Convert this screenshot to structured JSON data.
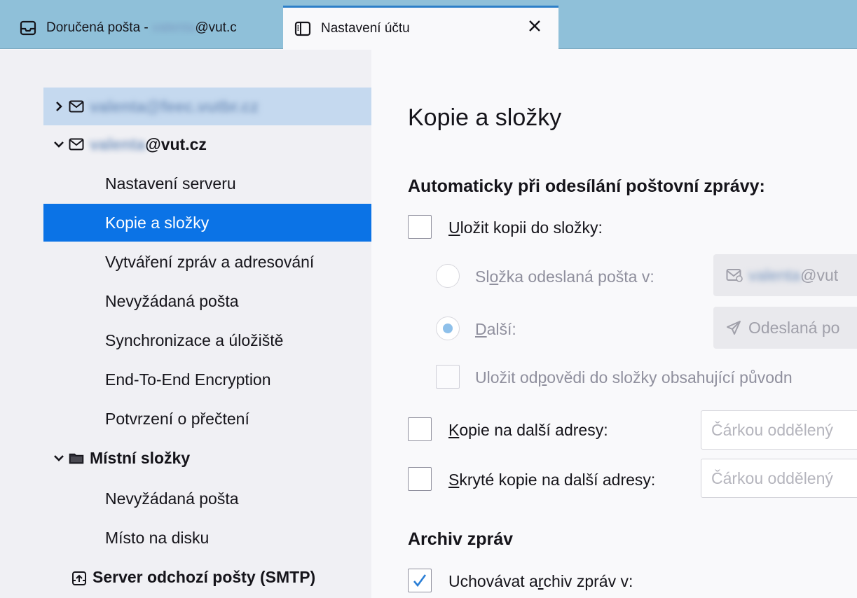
{
  "tabs": [
    {
      "icon": "inbox-icon",
      "title_prefix": "Doručená pošta - ",
      "title_redacted": "valenta",
      "title_suffix": "@vut.c"
    },
    {
      "icon": "settings-page-icon",
      "title": "Nastavení účtu",
      "close": "×"
    }
  ],
  "sidebar": {
    "account1": {
      "redacted": "valenta@feec.vutbr.cz"
    },
    "account2": {
      "redacted": "valenta",
      "suffix": "@vut.cz"
    },
    "items": [
      "Nastavení serveru",
      "Kopie a složky",
      "Vytváření zpráv a adresování",
      "Nevyžádaná pošta",
      "Synchronizace a úložiště",
      "End-To-End Encryption",
      "Potvrzení o přečtení"
    ],
    "local_folders": {
      "label": "Místní složky",
      "items": [
        "Nevyžádaná pošta",
        "Místo na disku"
      ]
    },
    "smtp": {
      "label": "Server odchozí pošty (SMTP)"
    }
  },
  "content": {
    "title": "Kopie a složky",
    "auto_send": {
      "heading": "Automaticky při odesílání poštovní zprávy:",
      "save_copy": {
        "pre": "",
        "u": "U",
        "post": "ložit kopii do složky:",
        "checked": false
      },
      "sent_folder": {
        "pre": "Sl",
        "u": "o",
        "post": "žka odeslaná pošta v:",
        "picker_redacted": "valenta",
        "picker_suffix": "@vut"
      },
      "other": {
        "pre": "",
        "u": "D",
        "post": "alší:",
        "picker_text": "Odeslaná po",
        "selected": true
      },
      "save_replies": {
        "pre": "Uložit od",
        "u": "p",
        "post": "ovědi do složky obsahující původn",
        "checked": false
      },
      "cc": {
        "pre": "",
        "u": "K",
        "post": "opie na další adresy:",
        "placeholder": "Čárkou oddělený",
        "checked": false
      },
      "bcc": {
        "pre": "",
        "u": "S",
        "post": "kryté kopie na další adresy:",
        "placeholder": "Čárkou oddělený",
        "checked": false
      }
    },
    "archive": {
      "heading": "Archiv zpráv",
      "keep": {
        "pre": "Uchovávat a",
        "u": "r",
        "post": "chiv zpráv v:",
        "checked": true
      }
    }
  },
  "colors": {
    "tabbar": "#8fc0d9",
    "active_tab_accent": "#2d7fc8",
    "selected_item": "#0b73e6",
    "account_highlight": "#c5d9ef",
    "sidebar_bg": "#f0f0f4",
    "content_bg": "#f9f9fb"
  }
}
